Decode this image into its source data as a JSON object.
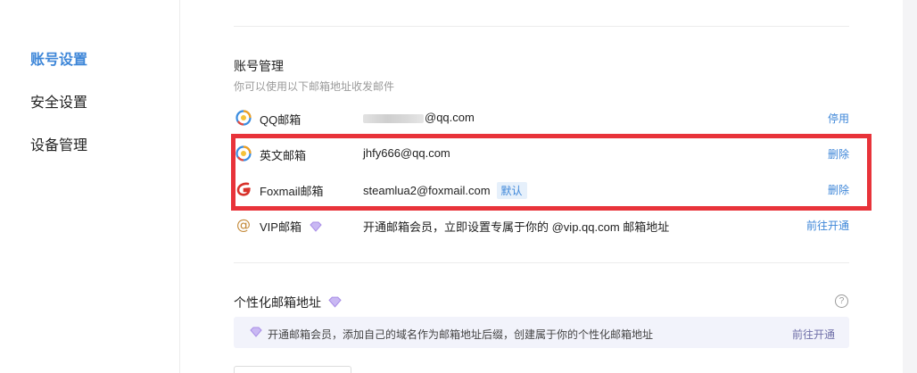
{
  "sidebar": {
    "items": [
      {
        "label": "账号设置",
        "active": true
      },
      {
        "label": "安全设置",
        "active": false
      },
      {
        "label": "设备管理",
        "active": false
      }
    ]
  },
  "account": {
    "title": "账号管理",
    "subtitle": "你可以使用以下邮箱地址收发邮件",
    "rows": [
      {
        "icon": "qq-mail-icon",
        "name": "QQ邮箱",
        "address": "@qq.com",
        "action": "停用"
      },
      {
        "icon": "qq-mail-icon",
        "name": "英文邮箱",
        "address": "jhfy666@qq.com",
        "action": "删除"
      },
      {
        "icon": "foxmail-icon",
        "name": "Foxmail邮箱",
        "address": "steamlua2@foxmail.com",
        "badge": "默认",
        "action": "删除"
      },
      {
        "icon": "at-sign-icon",
        "name": "VIP邮箱",
        "address": "开通邮箱会员，立即设置专属于你的 @vip.qq.com 邮箱地址",
        "action": "前往开通"
      }
    ]
  },
  "personal": {
    "title": "个性化邮箱地址",
    "help": "?",
    "banner_text": "开通邮箱会员，添加自己的域名作为邮箱地址后缀，创建属于你的个性化邮箱地址",
    "banner_action": "前往开通"
  },
  "colors": {
    "accent": "#3d86d8",
    "highlight": "#e8333a",
    "vip": "#a98ee6"
  }
}
